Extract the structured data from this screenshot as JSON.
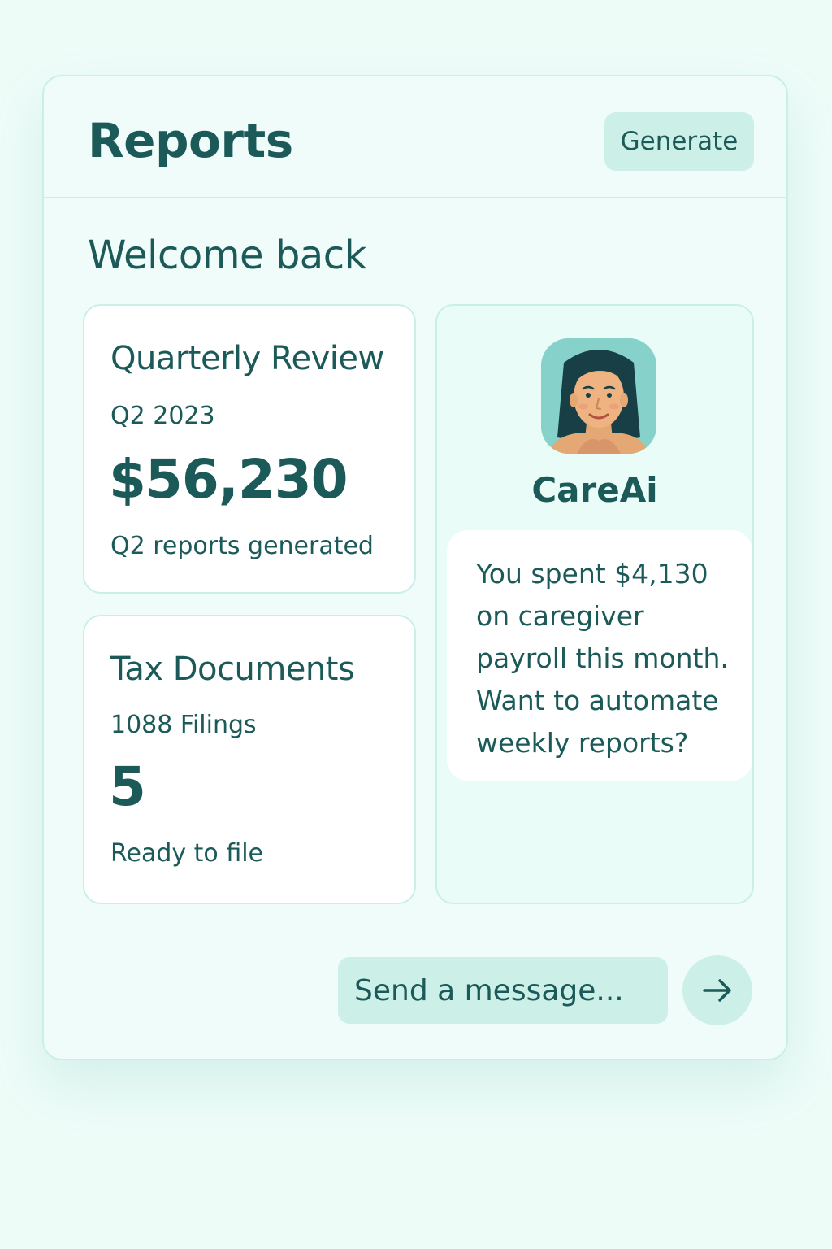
{
  "header": {
    "title": "Reports",
    "generate_label": "Generate"
  },
  "welcome": "Welcome back",
  "cards": [
    {
      "title": "Quarterly Review",
      "subtitle": "Q2 2023",
      "value": "$56,230",
      "note": "Q2 reports generated"
    },
    {
      "title": "Tax Documents",
      "subtitle": "1088 Filings",
      "value": "5",
      "note": "Ready to file"
    }
  ],
  "assistant": {
    "name": "CareAi",
    "avatar_icon": "woman-avatar-icon",
    "message": "You spent $4,130 on caregiver payroll this month. Want to automate weekly reports?"
  },
  "composer": {
    "placeholder": "Send a message...",
    "send_icon": "arrow-right-icon"
  },
  "colors": {
    "page_background": "#eefcf8",
    "panel_border": "#c9efe8",
    "accent_fill": "#ccefe8",
    "text_primary": "#1b5a58",
    "avatar_background": "#86d1c9"
  }
}
